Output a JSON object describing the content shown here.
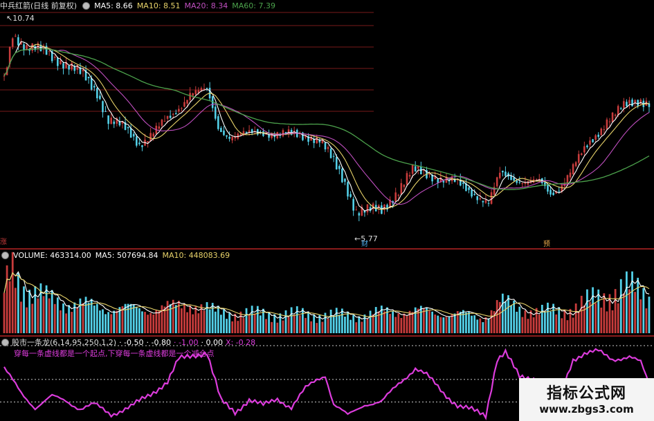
{
  "colors": {
    "up": "#c83c3c",
    "down": "#53d0e8",
    "ma5": "#ffffff",
    "ma10": "#e8d36a",
    "ma20": "#c04fc0",
    "ma60": "#4ca24c",
    "indicator": "#dc3cdc",
    "grid": "#7a1a1a",
    "separator": "#8b1c1c"
  },
  "price_panel": {
    "stock_title": "中兵红箭(日线 前复权)",
    "legend": [
      {
        "label": "MA5: 8.66",
        "color": "#ffffff"
      },
      {
        "label": "MA10: 8.51",
        "color": "#e8d36a"
      },
      {
        "label": "MA20: 8.34",
        "color": "#c04fc0"
      },
      {
        "label": "MA60: 7.39",
        "color": "#4ca24c"
      }
    ],
    "high_marker": "10.74",
    "low_marker": "5.77",
    "event_tag_1": "财",
    "event_tag_2": "预",
    "edge_tag": "涨"
  },
  "volume_panel": {
    "legend": [
      {
        "label": "VOLUME: 463314.00",
        "color": "#ffffff"
      },
      {
        "label": "MA5: 507694.84",
        "color": "#ffffff"
      },
      {
        "label": "MA10: 448083.69",
        "color": "#e8d36a"
      }
    ]
  },
  "indicator_panel": {
    "legend": [
      {
        "label": "股市一条龙(6,14,95,250,1,2)",
        "color": "#dddddd"
      },
      {
        "label": "· -0.50",
        "color": "#ffffff"
      },
      {
        "label": "· -0.80",
        "color": "#ffffff"
      },
      {
        "label": "· -1.00",
        "color": "#dc3cdc"
      },
      {
        "label": "· 0.00",
        "color": "#ffffff"
      },
      {
        "label": "X: -0.28",
        "color": "#dc3cdc"
      }
    ],
    "annotation": "穿每一条虚线都是一个起点,下穿每一条虚线都是一个减仓点"
  },
  "watermark": {
    "title": "指标公式网",
    "url": "www.zbgs3.com"
  },
  "chart_data": {
    "type": "candlestick",
    "price_high": 10.74,
    "price_low": 5.77,
    "ma_latest": {
      "MA5": 8.66,
      "MA10": 8.51,
      "MA20": 8.34,
      "MA60": 7.39
    },
    "volume_latest": {
      "VOLUME": 463314.0,
      "MA5": 507694.84,
      "MA10": 448083.69
    },
    "indicator_levels": [
      -0.5,
      -0.8,
      -1.0,
      0.0
    ],
    "indicator_x": -0.28,
    "price_keyframes": [
      [
        0,
        9.2
      ],
      [
        3,
        10.4
      ],
      [
        8,
        10.0
      ],
      [
        15,
        9.9
      ],
      [
        22,
        9.6
      ],
      [
        28,
        9.3
      ],
      [
        33,
        8.9
      ],
      [
        37,
        8.2
      ],
      [
        42,
        8.0
      ],
      [
        48,
        7.6
      ],
      [
        55,
        8.0
      ],
      [
        60,
        8.3
      ],
      [
        66,
        8.9
      ],
      [
        72,
        8.9
      ],
      [
        76,
        8.0
      ],
      [
        80,
        7.8
      ],
      [
        86,
        7.8
      ],
      [
        92,
        7.9
      ],
      [
        100,
        7.8
      ],
      [
        108,
        7.8
      ],
      [
        112,
        7.7
      ],
      [
        117,
        7.1
      ],
      [
        121,
        6.6
      ],
      [
        125,
        5.9
      ],
      [
        134,
        5.9
      ],
      [
        145,
        6.9
      ],
      [
        152,
        6.8
      ],
      [
        160,
        6.6
      ],
      [
        168,
        6.3
      ],
      [
        172,
        6.1
      ],
      [
        176,
        6.8
      ],
      [
        182,
        6.7
      ],
      [
        190,
        6.6
      ],
      [
        194,
        6.3
      ],
      [
        197,
        6.5
      ],
      [
        202,
        7.0
      ],
      [
        208,
        7.6
      ],
      [
        214,
        8.2
      ],
      [
        220,
        8.5
      ],
      [
        226,
        8.7
      ],
      [
        229,
        8.66
      ]
    ],
    "volume_keyframes": [
      [
        0,
        500000
      ],
      [
        3,
        800000
      ],
      [
        8,
        550000
      ],
      [
        15,
        430000
      ],
      [
        30,
        340000
      ],
      [
        45,
        300000
      ],
      [
        60,
        320000
      ],
      [
        66,
        380000
      ],
      [
        75,
        260000
      ],
      [
        90,
        240000
      ],
      [
        110,
        230000
      ],
      [
        125,
        220000
      ],
      [
        140,
        280000
      ],
      [
        155,
        260000
      ],
      [
        170,
        200000
      ],
      [
        176,
        380000
      ],
      [
        190,
        260000
      ],
      [
        200,
        290000
      ],
      [
        210,
        420000
      ],
      [
        220,
        560000
      ],
      [
        226,
        520000
      ],
      [
        229,
        463314
      ]
    ],
    "indicator_keyframes": [
      [
        0,
        -0.7
      ],
      [
        6,
        -0.92
      ],
      [
        11,
        -1.05
      ],
      [
        17,
        -0.95
      ],
      [
        22,
        -0.99
      ],
      [
        27,
        -1.06
      ],
      [
        32,
        -1.02
      ],
      [
        38,
        -1.11
      ],
      [
        45,
        -1.04
      ],
      [
        52,
        -0.93
      ],
      [
        58,
        -0.82
      ],
      [
        62,
        -0.62
      ],
      [
        68,
        -0.58
      ],
      [
        72,
        -0.56
      ],
      [
        77,
        -0.99
      ],
      [
        82,
        -1.09
      ],
      [
        87,
        -0.98
      ],
      [
        92,
        -1.03
      ],
      [
        97,
        -0.97
      ],
      [
        102,
        -1.05
      ],
      [
        107,
        -0.88
      ],
      [
        111,
        -0.8
      ],
      [
        114,
        -0.76
      ],
      [
        117,
        -1.02
      ],
      [
        122,
        -1.12
      ],
      [
        128,
        -1.02
      ],
      [
        134,
        -1.0
      ],
      [
        140,
        -0.84
      ],
      [
        146,
        -0.7
      ],
      [
        150,
        -0.76
      ],
      [
        156,
        -0.92
      ],
      [
        161,
        -1.03
      ],
      [
        166,
        -1.07
      ],
      [
        171,
        -1.12
      ],
      [
        175,
        -0.62
      ],
      [
        178,
        -0.56
      ],
      [
        183,
        -0.78
      ],
      [
        189,
        -0.79
      ],
      [
        194,
        -0.95
      ],
      [
        197,
        -0.97
      ],
      [
        202,
        -0.62
      ],
      [
        206,
        -0.57
      ],
      [
        211,
        -0.55
      ],
      [
        216,
        -0.62
      ],
      [
        222,
        -0.6
      ],
      [
        226,
        -0.65
      ],
      [
        229,
        -0.84
      ]
    ]
  }
}
